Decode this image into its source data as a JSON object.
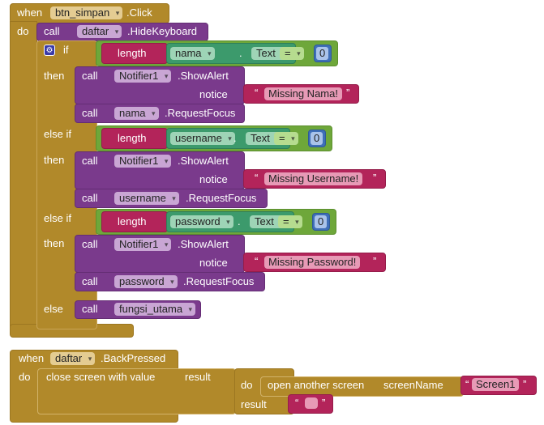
{
  "event1": {
    "when": "when",
    "component": "btn_simpan",
    "event": ".Click",
    "do": "do"
  },
  "hide": {
    "call": "call",
    "component": "daftar",
    "method": ".HideKeyboard"
  },
  "ifblock": {
    "if": "if",
    "then": "then",
    "elseif": "else if",
    "else": "else",
    "gear_icon": "gear-icon"
  },
  "conditions": [
    {
      "fn": "length",
      "component": "nama",
      "prop": "Text",
      "dot": ".",
      "op": "=",
      "value": "0"
    },
    {
      "fn": "length",
      "component": "username",
      "prop": "Text",
      "dot": ".",
      "op": "=",
      "value": "0"
    },
    {
      "fn": "length",
      "component": "password",
      "prop": "Text",
      "dot": ".",
      "op": "=",
      "value": "0"
    }
  ],
  "branches": [
    {
      "call": "call",
      "notifier": "Notifier1",
      "method": ".ShowAlert",
      "notice": "notice",
      "message": "Missing Nama!",
      "focus_component": "nama",
      "focus_method": ".RequestFocus"
    },
    {
      "call": "call",
      "notifier": "Notifier1",
      "method": ".ShowAlert",
      "notice": "notice",
      "message": "Missing Username!",
      "focus_component": "username",
      "focus_method": ".RequestFocus"
    },
    {
      "call": "call",
      "notifier": "Notifier1",
      "method": ".ShowAlert",
      "notice": "notice",
      "message": "Missing Password!",
      "focus_component": "password",
      "focus_method": ".RequestFocus"
    }
  ],
  "else_call": {
    "call": "call",
    "procedure": "fungsi_utama"
  },
  "event2": {
    "when": "when",
    "component": "daftar",
    "event": ".BackPressed",
    "do": "do"
  },
  "close": {
    "label": "close screen with value",
    "result": "result"
  },
  "doresult": {
    "do": "do",
    "result": "result",
    "result_value": ""
  },
  "open": {
    "label": "open another screen",
    "param": "screenName",
    "value": "Screen1"
  },
  "quote": "“",
  "quote_end": "”"
}
